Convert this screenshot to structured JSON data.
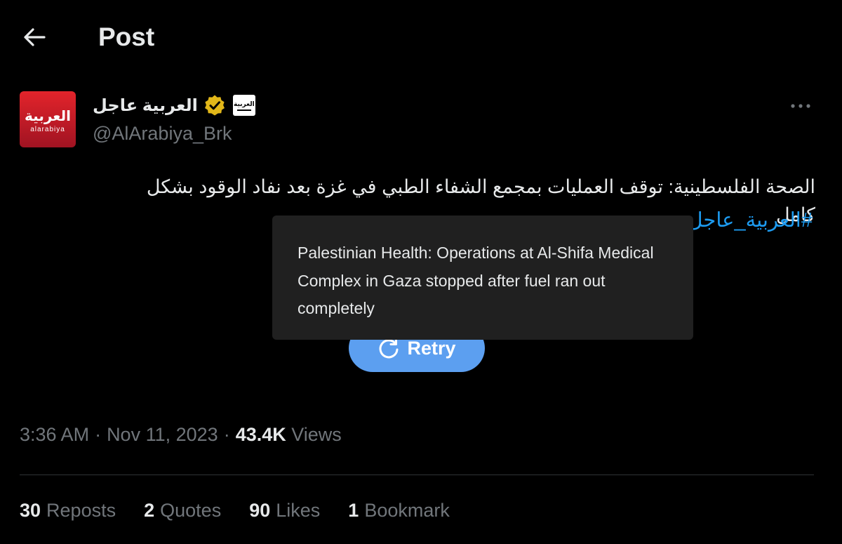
{
  "header": {
    "title": "Post",
    "back_icon": "arrow-left-icon"
  },
  "author": {
    "display_name": "العربية عاجل",
    "handle": "@AlArabiya_Brk",
    "avatar_text_ar": "العربية",
    "avatar_text_en": "alarabiya",
    "affiliate_badge_text": "العربية",
    "verified_color": "#e2b719",
    "avatar_color": "#d01d2a"
  },
  "tweet": {
    "text": "الصحة الفلسطينية: توقف العمليات بمجمع الشفاء الطبي في غزة بعد نفاد الوقود بشكل كامل",
    "hashtag": "#العربية_عاجل",
    "hashtag_color": "#1d9bf0"
  },
  "media": {
    "retry_label": "Retry",
    "retry_icon": "refresh-icon",
    "retry_color": "#5c9ff0"
  },
  "tooltip": {
    "text": "Palestinian Health: Operations at Al-Shifa Medical Complex in Gaza stopped after fuel ran out completely"
  },
  "meta": {
    "time": "3:36 AM",
    "separator": "·",
    "date": "Nov 11, 2023",
    "views_count": "43.4K",
    "views_label": "Views"
  },
  "stats": {
    "reposts_count": "30",
    "reposts_label": "Reposts",
    "quotes_count": "2",
    "quotes_label": "Quotes",
    "likes_count": "90",
    "likes_label": "Likes",
    "bookmarks_count": "1",
    "bookmarks_label": "Bookmark"
  },
  "more_icon": "more-horizontal-icon"
}
